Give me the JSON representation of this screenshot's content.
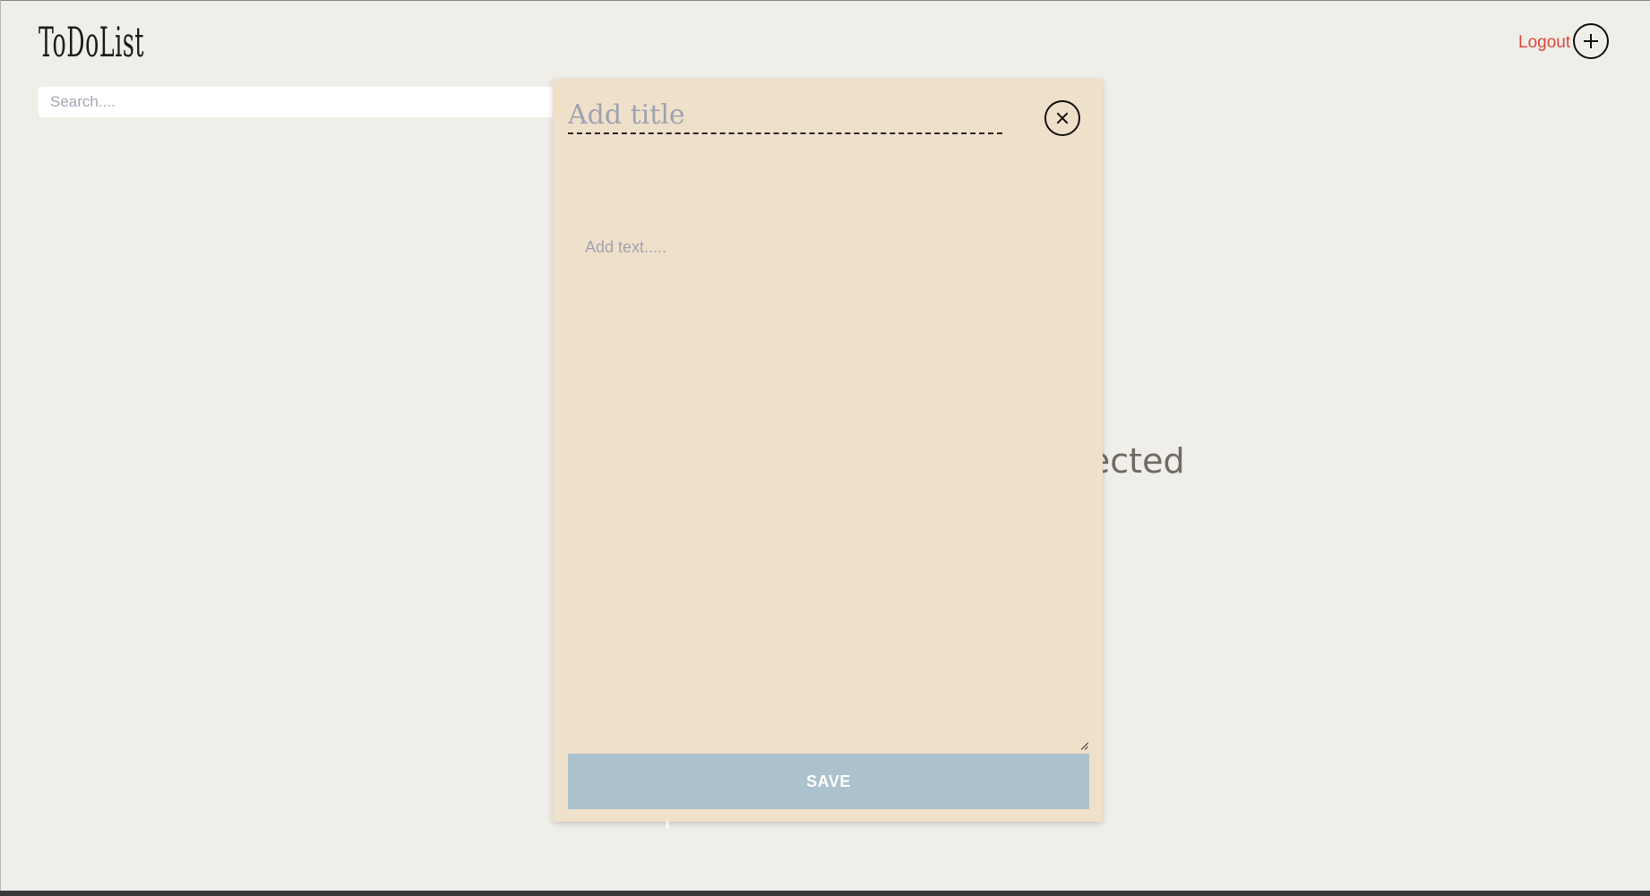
{
  "header": {
    "app_title": "ToDoList",
    "logout_label": "Logout",
    "add_icon": "plus-circle-icon"
  },
  "search": {
    "placeholder": "Search...."
  },
  "main": {
    "empty_state_text": "No Task Selected"
  },
  "modal": {
    "title_placeholder": "Add title",
    "title_value": "",
    "text_placeholder": "Add text.....",
    "text_value": "",
    "close_icon": "close-circle-icon",
    "save_label": "SAVE"
  },
  "colors": {
    "background": "#efeee8",
    "modal_background": "#efe0ca",
    "save_button": "#abc2cc",
    "logout": "#d94a3d",
    "empty_state_text": "#6e6a64"
  }
}
